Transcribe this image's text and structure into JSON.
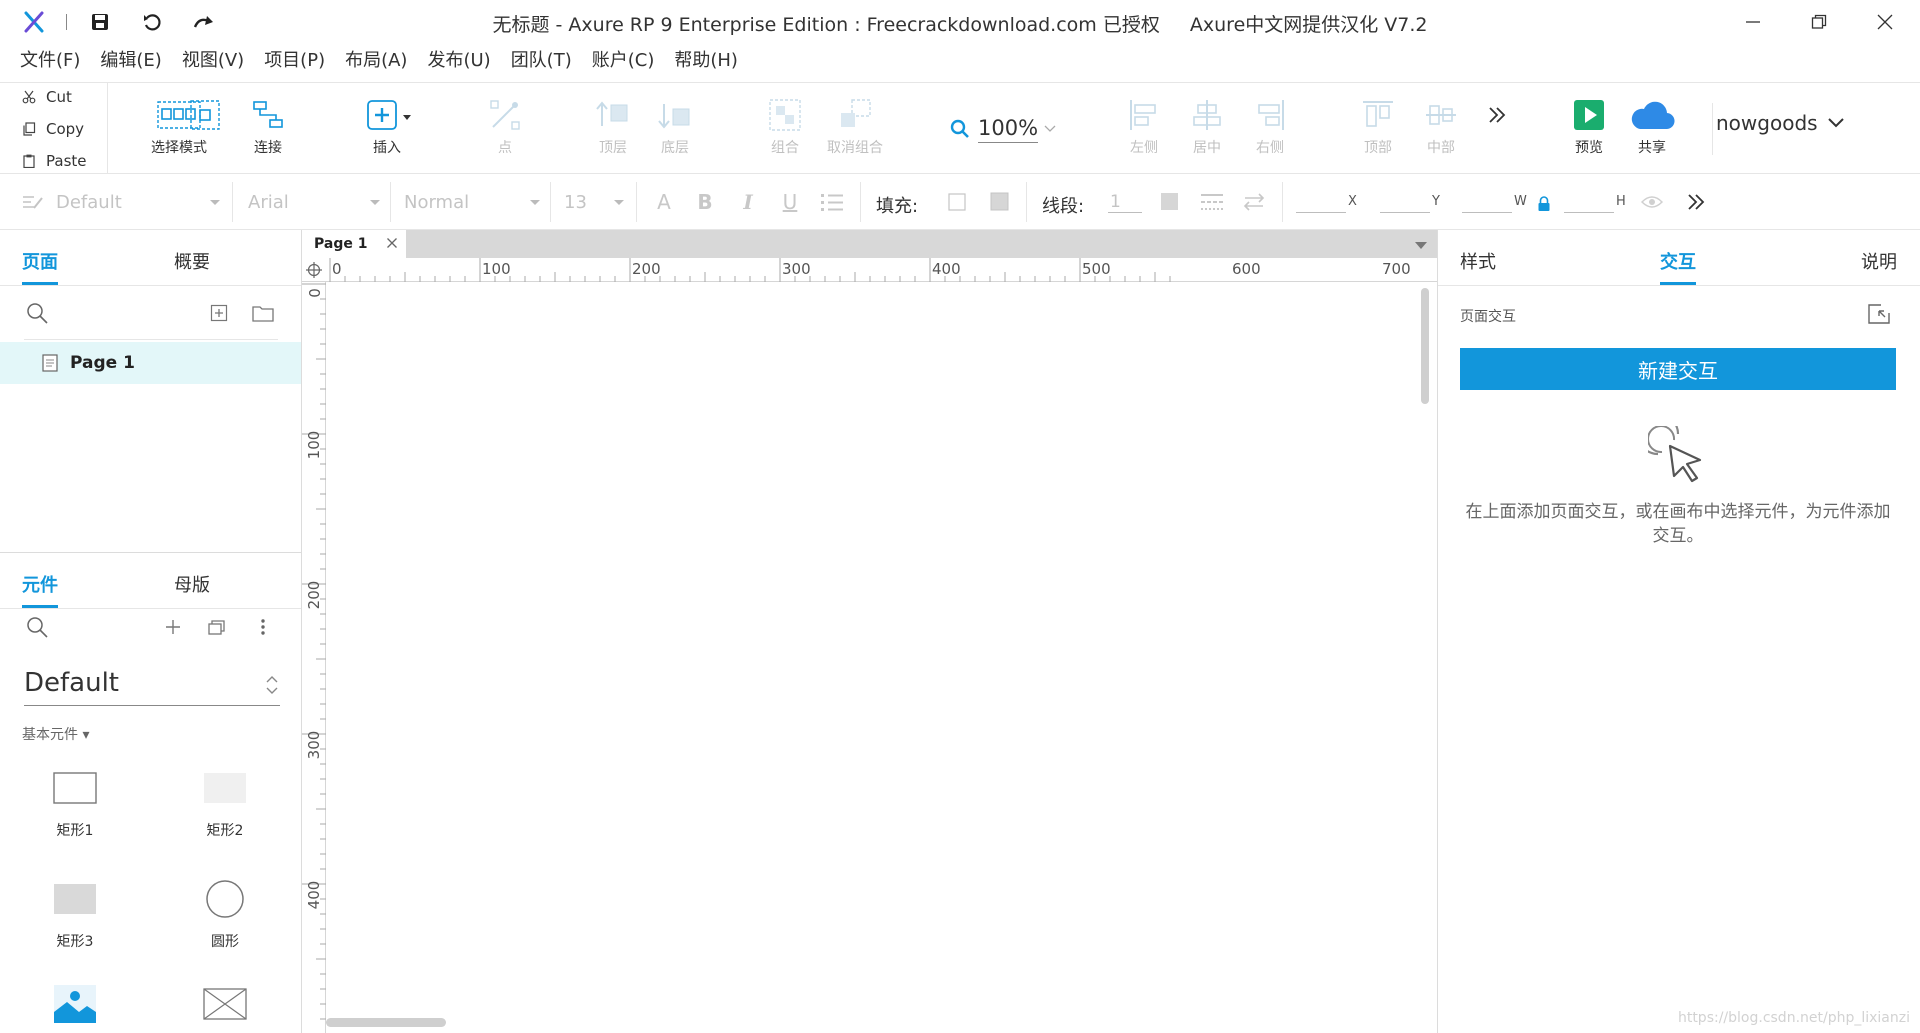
{
  "titlebar": {
    "title": "无标题 - Axure RP 9 Enterprise Edition : Freecrackdownload.com 已授权",
    "localization": "Axure中文网提供汉化 V7.2",
    "quick_icons": [
      "save-icon",
      "undo-icon",
      "redo-icon"
    ],
    "window_controls": [
      "minimize-icon",
      "restore-icon",
      "close-icon"
    ]
  },
  "menubar": {
    "items": [
      "文件(F)",
      "编辑(E)",
      "视图(V)",
      "项目(P)",
      "布局(A)",
      "发布(U)",
      "团队(T)",
      "账户(C)",
      "帮助(H)"
    ]
  },
  "toolbar": {
    "clipboard": {
      "cut": "Cut",
      "copy": "Copy",
      "paste": "Paste"
    },
    "select_mode": "选择模式",
    "connect": "连接",
    "insert": "插入",
    "point": "点",
    "top_layer": "顶层",
    "bottom_layer": "底层",
    "group": "组合",
    "ungroup": "取消组合",
    "zoom": "100%",
    "align_left": "左侧",
    "align_center": "居中",
    "align_right": "右侧",
    "align_top": "顶部",
    "align_middle": "中部",
    "preview": "预览",
    "share": "共享",
    "user": "nowgoods",
    "colors": {
      "accent": "#1296db",
      "preview": "#1aad6e",
      "share": "#2e8ae6"
    }
  },
  "formatbar": {
    "style": "Default",
    "font": "Arial",
    "weight": "Normal",
    "size": "13",
    "fill_label": "填充:",
    "stroke_label": "线段:",
    "stroke_value": "1",
    "x_label": "X",
    "y_label": "Y",
    "w_label": "W",
    "h_label": "H"
  },
  "left_panel": {
    "tabs": [
      "页面",
      "概要"
    ],
    "pages": [
      {
        "name": "Page 1"
      }
    ],
    "library_tabs": [
      "元件",
      "母版"
    ],
    "library": "Default",
    "category": "基本元件 ▾",
    "widgets": [
      "矩形1",
      "矩形2",
      "矩形3",
      "圆形"
    ]
  },
  "canvas": {
    "tab": "Page 1",
    "ruler_h": [
      "0",
      "100",
      "200",
      "300",
      "400",
      "500",
      "600",
      "700"
    ],
    "ruler_v": [
      "0",
      "100",
      "200",
      "300",
      "400"
    ]
  },
  "right_panel": {
    "tabs": [
      "样式",
      "交互",
      "说明"
    ],
    "section_title": "页面交互",
    "new_interaction": "新建交互",
    "hint": "在上面添加页面交互，或在画布中选择元件，为元件添加交互。"
  },
  "watermark": "https://blog.csdn.net/php_lixianzi"
}
